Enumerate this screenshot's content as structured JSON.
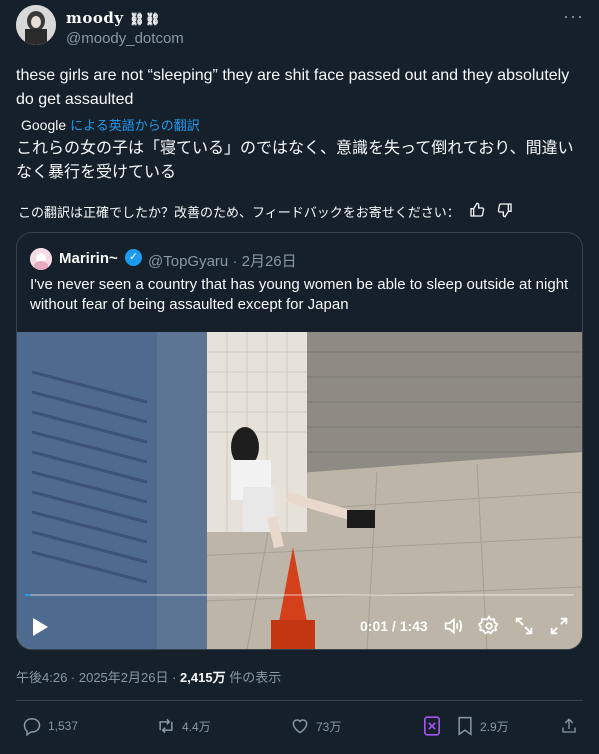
{
  "author": {
    "display_name": "moody",
    "handle": "@moody_dotcom"
  },
  "more_label": "···",
  "tweet": {
    "text": "these girls are not “sleeping” they are shit face passed out and they absolutely do get assaulted",
    "translation_provider": "Google",
    "translation_link": "による英語からの翻訳",
    "translated_text": "これらの女の子は「寝ている」のではなく、意識を失って倒れており、間違いなく暴行を受けている",
    "feedback_prompt": "この翻訳は正確でしたか？改善のため、フィードバックをお寄せください："
  },
  "quoted": {
    "display_name": "Maririn~",
    "handle": "@TopGyaru",
    "separator": "·",
    "date": "2月26日",
    "text": "I've never seen a country that has young women be able to sleep outside at night without fear of being assaulted except for Japan",
    "video": {
      "time": "0:01 / 1:43",
      "progress": 0.01
    }
  },
  "meta": {
    "time": "午後4:26 · 2025年2月26日 · ",
    "views_count": "2,415万",
    "views_label": " 件の表示"
  },
  "actions": {
    "replies": "1,537",
    "reposts": "4.4万",
    "likes": "73万",
    "bookmarks": "2.9万"
  },
  "colors": {
    "background": "#15202b",
    "accent": "#1d9bf0",
    "muted": "#8b98a5",
    "border": "#38444d"
  }
}
